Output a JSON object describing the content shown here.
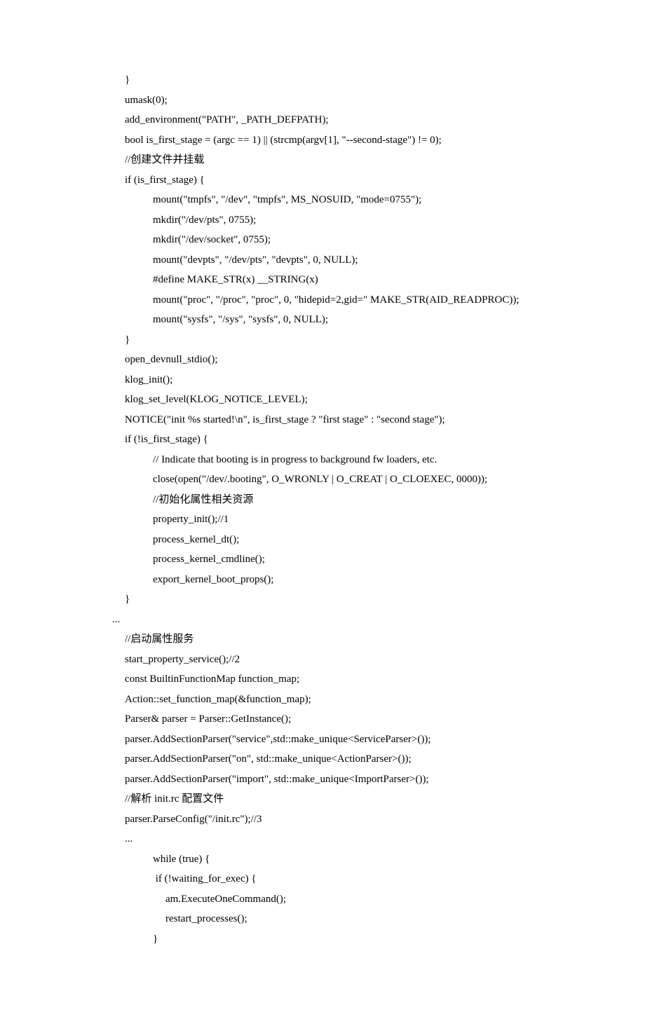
{
  "lines": [
    {
      "cls": "i1",
      "text": "}"
    },
    {
      "cls": "i1",
      "text": "umask(0);"
    },
    {
      "cls": "i1",
      "text": "add_environment(\"PATH\", _PATH_DEFPATH);"
    },
    {
      "cls": "i1",
      "text": "bool is_first_stage = (argc == 1) || (strcmp(argv[1], \"--second-stage\") != 0);"
    },
    {
      "cls": "i1",
      "text": "//创建文件并挂载"
    },
    {
      "cls": "i1",
      "text": "if (is_first_stage) {"
    },
    {
      "cls": "i3",
      "text": "mount(\"tmpfs\", \"/dev\", \"tmpfs\", MS_NOSUID, \"mode=0755\");"
    },
    {
      "cls": "i3",
      "text": "mkdir(\"/dev/pts\", 0755);"
    },
    {
      "cls": "i3",
      "text": "mkdir(\"/dev/socket\", 0755);"
    },
    {
      "cls": "i3",
      "text": "mount(\"devpts\", \"/dev/pts\", \"devpts\", 0, NULL);"
    },
    {
      "cls": "i3",
      "text": "#define MAKE_STR(x) __STRING(x)"
    },
    {
      "cls": "i3",
      "text": "mount(\"proc\", \"/proc\", \"proc\", 0, \"hidepid=2,gid=\" MAKE_STR(AID_READPROC));"
    },
    {
      "cls": "i3",
      "text": "mount(\"sysfs\", \"/sys\", \"sysfs\", 0, NULL);"
    },
    {
      "cls": "i1",
      "text": "}"
    },
    {
      "cls": "i1",
      "text": "open_devnull_stdio();"
    },
    {
      "cls": "i1",
      "text": "klog_init();"
    },
    {
      "cls": "i1",
      "text": "klog_set_level(KLOG_NOTICE_LEVEL);"
    },
    {
      "cls": "i1",
      "text": "NOTICE(\"init %s started!\\n\", is_first_stage ? \"first stage\" : \"second stage\");"
    },
    {
      "cls": "i1",
      "text": "if (!is_first_stage) {"
    },
    {
      "cls": "i3",
      "text": "// Indicate that booting is in progress to background fw loaders, etc."
    },
    {
      "cls": "i3",
      "text": "close(open(\"/dev/.booting\", O_WRONLY | O_CREAT | O_CLOEXEC, 0000));"
    },
    {
      "cls": "i3",
      "text": "//初始化属性相关资源"
    },
    {
      "cls": "i3",
      "text": "property_init();//1"
    },
    {
      "cls": "i3",
      "text": "process_kernel_dt();"
    },
    {
      "cls": "i3",
      "text": "process_kernel_cmdline();"
    },
    {
      "cls": "i3",
      "text": "export_kernel_boot_props();"
    },
    {
      "cls": "i1",
      "text": "}"
    },
    {
      "cls": "ellipsis",
      "text": "..."
    },
    {
      "cls": "i1",
      "text": "//启动属性服务"
    },
    {
      "cls": "i1",
      "text": "start_property_service();//2"
    },
    {
      "cls": "i1",
      "text": "const BuiltinFunctionMap function_map;"
    },
    {
      "cls": "i1",
      "text": "Action::set_function_map(&function_map);"
    },
    {
      "cls": "i1",
      "text": "Parser& parser = Parser::GetInstance();"
    },
    {
      "cls": "i1",
      "text": "parser.AddSectionParser(\"service\",std::make_unique<ServiceParser>());"
    },
    {
      "cls": "i1",
      "text": "parser.AddSectionParser(\"on\", std::make_unique<ActionParser>());"
    },
    {
      "cls": "i1",
      "text": "parser.AddSectionParser(\"import\", std::make_unique<ImportParser>());"
    },
    {
      "cls": "i1",
      "text": "//解析 init.rc 配置文件"
    },
    {
      "cls": "i1",
      "text": "parser.ParseConfig(\"/init.rc\");//3"
    },
    {
      "cls": "i1",
      "text": "..."
    },
    {
      "cls": "i3",
      "text": "while (true) {"
    },
    {
      "cls": "i3",
      "text": " if (!waiting_for_exec) {"
    },
    {
      "cls": "i4",
      "text": "am.ExecuteOneCommand();"
    },
    {
      "cls": "i4",
      "text": "restart_processes();"
    },
    {
      "cls": "i3",
      "text": "}"
    }
  ]
}
